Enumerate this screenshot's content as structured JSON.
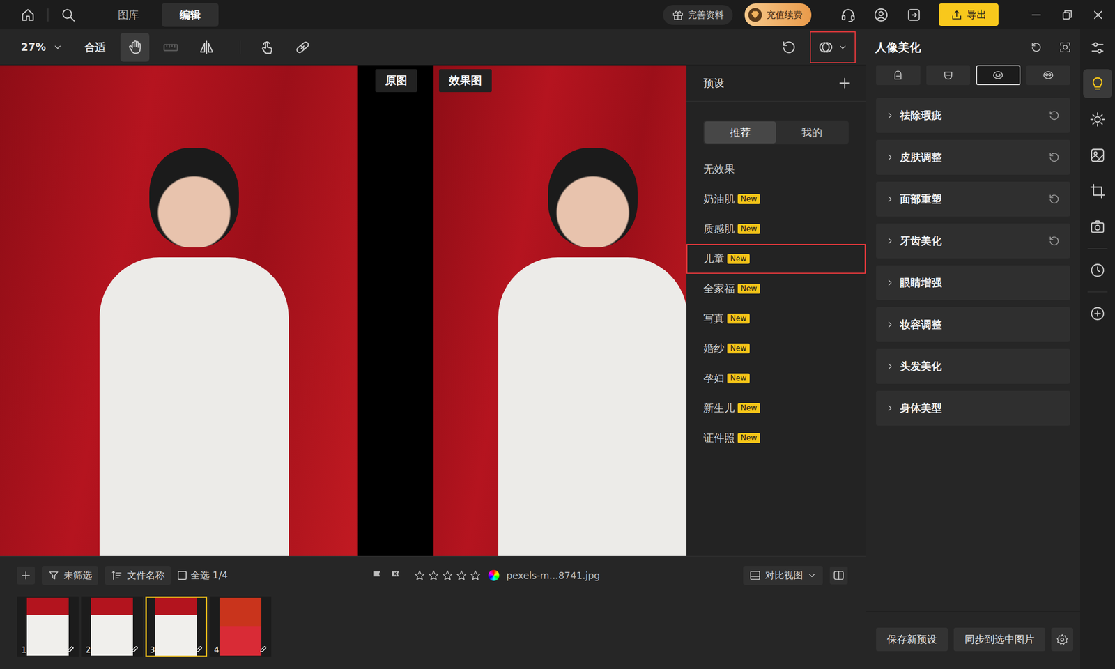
{
  "app_bar": {
    "tabs": [
      {
        "label": "图库",
        "selected": false
      },
      {
        "label": "编辑",
        "selected": true
      }
    ],
    "profile_button": "完善资料",
    "recharge_button": "充值续费",
    "export_button": "导出"
  },
  "toolbar": {
    "zoom": "27%",
    "fit_button": "合适",
    "tools": [
      {
        "selected": true,
        "disabled": false
      },
      {
        "selected": false,
        "disabled": true
      },
      {
        "selected": false,
        "disabled": false
      },
      {
        "selected": false,
        "disabled": false
      },
      {
        "selected": false,
        "disabled": false
      }
    ],
    "preset_toggle": {
      "open": true
    }
  },
  "compare": {
    "before_label": "原图",
    "after_label": "效果图"
  },
  "presets": {
    "title": "预设",
    "tabs": [
      {
        "label": "推荐",
        "selected": true
      },
      {
        "label": "我的",
        "selected": false
      }
    ],
    "items": [
      {
        "label": "无效果",
        "badge": "",
        "selected": false
      },
      {
        "label": "奶油肌",
        "badge": "New",
        "selected": false
      },
      {
        "label": "质感肌",
        "badge": "New",
        "selected": false
      },
      {
        "label": "儿童",
        "badge": "New",
        "selected": true
      },
      {
        "label": "全家福",
        "badge": "New",
        "selected": false
      },
      {
        "label": "写真",
        "badge": "New",
        "selected": false
      },
      {
        "label": "婚纱",
        "badge": "New",
        "selected": false
      },
      {
        "label": "孕妇",
        "badge": "New",
        "selected": false
      },
      {
        "label": "新生儿",
        "badge": "New",
        "selected": false
      },
      {
        "label": "证件照",
        "badge": "New",
        "selected": false
      }
    ]
  },
  "portrait_panel": {
    "title": "人像美化",
    "tabs": [
      {
        "selected": false
      },
      {
        "selected": false
      },
      {
        "selected": true
      },
      {
        "selected": false
      }
    ],
    "sections": [
      {
        "label": "祛除瑕疵",
        "expanded": false,
        "modified": true
      },
      {
        "label": "皮肤调整",
        "expanded": false,
        "modified": true
      },
      {
        "label": "面部重塑",
        "expanded": false,
        "modified": true
      },
      {
        "label": "牙齿美化",
        "expanded": false,
        "modified": true
      },
      {
        "label": "眼睛增强",
        "expanded": false,
        "modified": false
      },
      {
        "label": "妆容调整",
        "expanded": false,
        "modified": false
      },
      {
        "label": "头发美化",
        "expanded": false,
        "modified": false
      },
      {
        "label": "身体美型",
        "expanded": false,
        "modified": false
      }
    ],
    "buttons": [
      "保存新预设",
      "同步到选中图片"
    ]
  },
  "side_rail": [
    {
      "selected": false
    },
    {
      "selected": true
    },
    {
      "selected": false
    },
    {
      "selected": false
    },
    {
      "selected": false
    },
    {
      "selected": false
    },
    {
      "selected": false
    },
    {
      "selected": false
    }
  ],
  "filmstrip": {
    "filter": "未筛选",
    "sort": "文件名称",
    "select_all": {
      "label": "全选 1/4",
      "checked": false
    },
    "flags": [
      {
        "kind": "pick",
        "on": false
      },
      {
        "kind": "reject",
        "on": false
      }
    ],
    "stars": 0,
    "filename": "pexels-m...8741.jpg",
    "view": "对比视图",
    "thumbnails": [
      {
        "number": "1",
        "selected": false
      },
      {
        "number": "2",
        "selected": false
      },
      {
        "number": "3",
        "selected": true
      },
      {
        "number": "4",
        "selected": false
      }
    ]
  }
}
